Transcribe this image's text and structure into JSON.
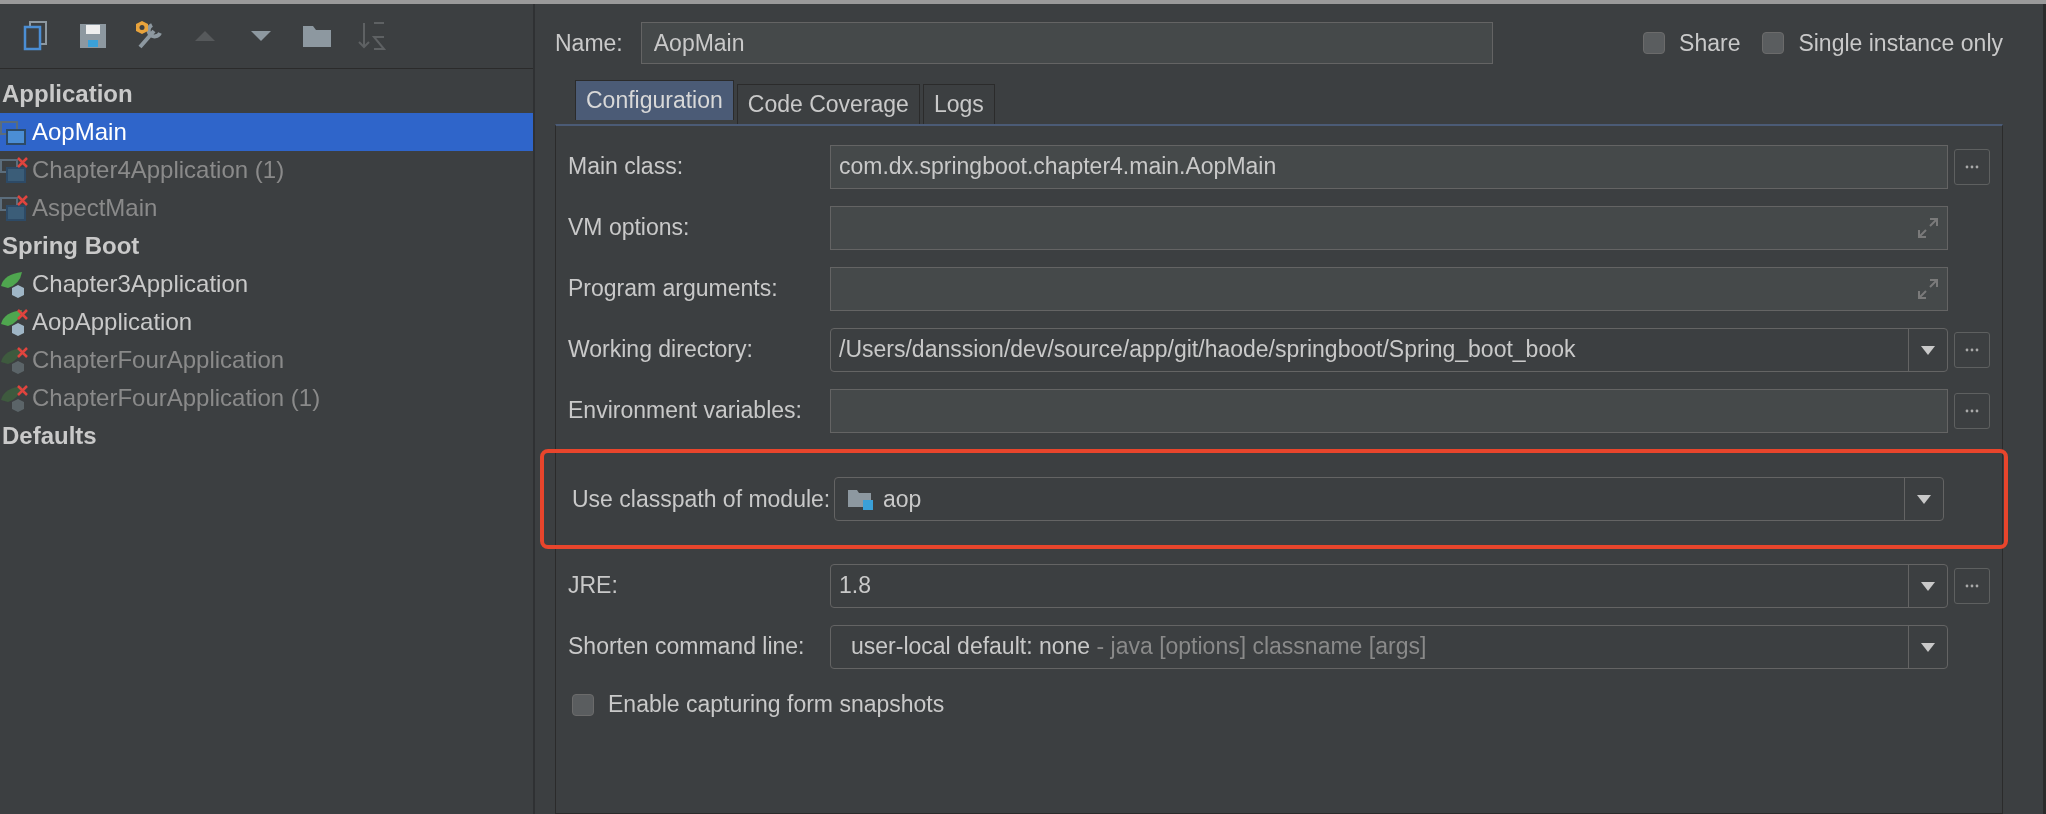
{
  "tree": [
    {
      "label": "Application",
      "kind": "application",
      "children": [
        {
          "label": "AopMain",
          "selected": true,
          "disabled": false,
          "error": false
        },
        {
          "label": "Chapter4Application (1)",
          "selected": false,
          "disabled": true,
          "error": true
        },
        {
          "label": "AspectMain",
          "selected": false,
          "disabled": true,
          "error": true
        }
      ]
    },
    {
      "label": "Spring Boot",
      "kind": "spring_boot",
      "children": [
        {
          "label": "Chapter3Application",
          "selected": false,
          "disabled": false,
          "error": false
        },
        {
          "label": "AopApplication",
          "selected": false,
          "disabled": false,
          "error": true
        },
        {
          "label": "ChapterFourApplication",
          "selected": false,
          "disabled": true,
          "error": true
        },
        {
          "label": "ChapterFourApplication (1)",
          "selected": false,
          "disabled": true,
          "error": true
        }
      ]
    },
    {
      "label": "Defaults"
    }
  ],
  "name": {
    "label": "Name:",
    "value": "AopMain"
  },
  "options": [
    {
      "label": "Share",
      "checked": false
    },
    {
      "label": "Single instance only",
      "checked": false
    }
  ],
  "tabs": [
    {
      "label": "Configuration",
      "selected": true
    },
    {
      "label": "Code Coverage",
      "selected": false
    },
    {
      "label": "Logs",
      "selected": false
    }
  ],
  "rows": [
    {
      "kind": "text",
      "label": "Main class:",
      "value": "com.dx.springboot.chapter4.main.AopMain",
      "browse": true,
      "highlighted": false
    },
    {
      "kind": "expand",
      "label": "VM options:",
      "browse": false,
      "highlighted": false
    },
    {
      "kind": "expand",
      "label": "Program arguments:",
      "browse": false,
      "highlighted": false
    },
    {
      "kind": "dropdown",
      "label": "Working directory:",
      "value": "/Users/danssion/dev/source/app/git/haode/springboot/Spring_boot_book",
      "browse": true,
      "highlighted": false
    },
    {
      "kind": "text",
      "label": "Environment variables:",
      "browse": true,
      "highlighted": false
    },
    {
      "kind": "module",
      "label": "Use classpath of module:",
      "value": "aop",
      "browse": false,
      "highlighted": true
    },
    {
      "kind": "dropdown",
      "label": "JRE:",
      "value": "1.8",
      "browse": true,
      "highlighted": false
    },
    {
      "kind": "dropdown",
      "label": "Shorten command line:",
      "value": "user-local default: none",
      "hint": " - java [options] classname [args]",
      "browse": false,
      "highlighted": false
    }
  ],
  "snapshot": {
    "label": "Enable capturing form snapshots",
    "checked": false
  }
}
